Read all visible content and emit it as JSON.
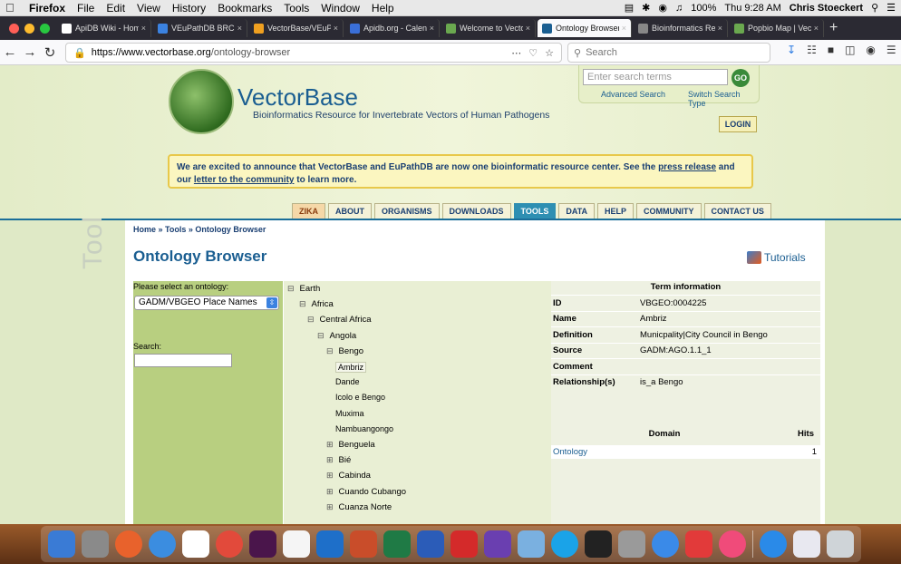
{
  "menubar": {
    "app": "Firefox",
    "items": [
      "File",
      "Edit",
      "View",
      "History",
      "Bookmarks",
      "Tools",
      "Window",
      "Help"
    ],
    "battery": "100%",
    "clock": "Thu 9:28 AM",
    "user": "Chris Stoeckert"
  },
  "tabs": [
    {
      "label": "ApiDB Wiki - Home",
      "color": "#ffffff"
    },
    {
      "label": "VEuPathDB BRC -",
      "color": "#3b82e0"
    },
    {
      "label": "VectorBase/VEuPa",
      "color": "#f0a020"
    },
    {
      "label": "Apidb.org - Calend",
      "color": "#3a6fd8"
    },
    {
      "label": "Welcome to Vecto",
      "color": "#6aa84f"
    },
    {
      "label": "Ontology Browser",
      "color": "#1a5e91",
      "active": true
    },
    {
      "label": "Bioinformatics Res",
      "color": "#888888"
    },
    {
      "label": "Popbio Map | Vect",
      "color": "#6aa84f"
    }
  ],
  "browser": {
    "url_host": "https://www.vectorbase.org",
    "url_path": "/ontology-browser",
    "search_placeholder": "Search"
  },
  "site": {
    "title": "VectorBase",
    "subtitle": "Bioinformatics Resource for Invertebrate Vectors of Human Pathogens",
    "search_placeholder": "Enter search terms",
    "go": "GO",
    "advanced_search": "Advanced Search",
    "switch_search": "Switch Search Type",
    "login": "LOGIN",
    "announce_1": "We are excited to announce that VectorBase and EuPathDB are now one bioinformatic resource center. See the ",
    "announce_link1": "press release",
    "announce_2": " and our ",
    "announce_link2": "letter to the community",
    "announce_3": " to learn more.",
    "nav": [
      "ZIKA",
      "ABOUT",
      "ORGANISMS",
      "DOWNLOADS",
      "TOOLS",
      "DATA",
      "HELP",
      "COMMUNITY",
      "CONTACT US"
    ]
  },
  "page": {
    "breadcrumb": "Home » Tools » Ontology Browser",
    "title": "Ontology Browser",
    "tutorials": "Tutorials",
    "tool_word": "Tool",
    "select_label": "Please select an ontology:",
    "select_value": "GADM/VBGEO Place Names",
    "search_label": "Search:"
  },
  "tree": [
    {
      "label": "Earth",
      "toggle": "⊟"
    },
    {
      "label": "Africa",
      "toggle": "⊟"
    },
    {
      "label": "Central Africa",
      "toggle": "⊟"
    },
    {
      "label": "Angola",
      "toggle": "⊟"
    },
    {
      "label": "Bengo",
      "toggle": "⊟"
    },
    {
      "label": "Ambriz",
      "toggle": ""
    },
    {
      "label": "Dande",
      "toggle": ""
    },
    {
      "label": "Icolo e Bengo",
      "toggle": ""
    },
    {
      "label": "Muxima",
      "toggle": ""
    },
    {
      "label": "Nambuangongo",
      "toggle": ""
    },
    {
      "label": "Benguela",
      "toggle": "⊞"
    },
    {
      "label": "Bié",
      "toggle": "⊞"
    },
    {
      "label": "Cabinda",
      "toggle": "⊞"
    },
    {
      "label": "Cuando Cubango",
      "toggle": "⊞"
    },
    {
      "label": "Cuanza Norte",
      "toggle": "⊞"
    }
  ],
  "term": {
    "header": "Term information",
    "rows": [
      {
        "k": "ID",
        "v": "VBGEO:0004225"
      },
      {
        "k": "Name",
        "v": "Ambriz"
      },
      {
        "k": "Definition",
        "v": "Municpality|City Council in Bengo"
      },
      {
        "k": "Source",
        "v": "GADM:AGO.1.1_1"
      },
      {
        "k": "Comment",
        "v": ""
      },
      {
        "k": "Relationship(s)",
        "v": "is_a Bengo"
      }
    ],
    "domain_header": "Domain",
    "hits_header": "Hits",
    "domain": "Ontology",
    "hits": "1"
  },
  "dock": [
    "finder",
    "system-preferences",
    "firefox",
    "safari",
    "calendar",
    "chrome",
    "slack",
    "textedit",
    "outlook",
    "powerpoint",
    "excel",
    "word",
    "acrobat",
    "visual-studio",
    "preview",
    "skype",
    "terminal",
    "calculator",
    "messages",
    "f5",
    "itunes",
    "app-store",
    "documents",
    "trash"
  ]
}
